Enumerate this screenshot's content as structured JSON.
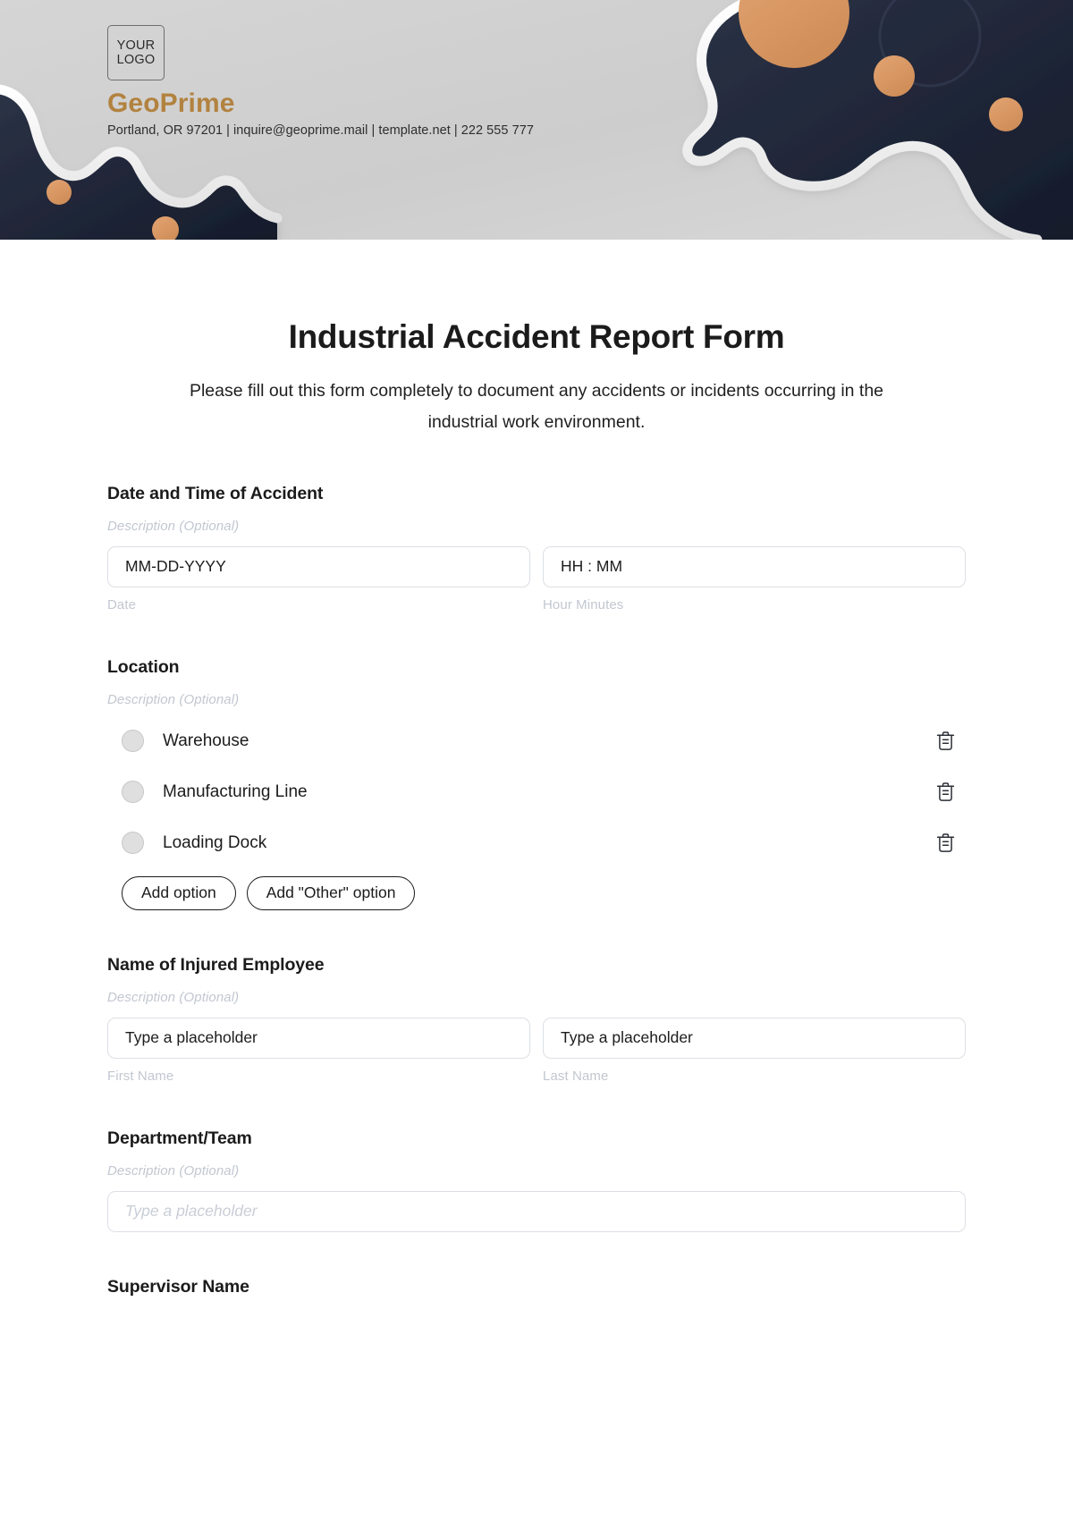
{
  "brand": {
    "logo_line1": "YOUR",
    "logo_line2": "LOGO",
    "name": "GeoPrime",
    "contact": "Portland, OR 97201 | inquire@geoprime.mail | template.net | 222 555 777",
    "accent_color": "#b2823f",
    "banner_dark": "#232b3b",
    "banner_bg": "#d2d2d2"
  },
  "form": {
    "title": "Industrial Accident Report Form",
    "subtitle": "Please fill out this form completely to document any accidents or incidents occurring in the industrial work environment."
  },
  "sections": {
    "datetime": {
      "label": "Date and Time of Accident",
      "description": "Description (Optional)",
      "date_value": "MM-DD-YYYY",
      "date_sublabel": "Date",
      "time_value": "HH : MM",
      "time_sublabel": "Hour Minutes"
    },
    "location": {
      "label": "Location",
      "description": "Description (Optional)",
      "options": [
        {
          "text": "Warehouse",
          "delete_icon": "trash-icon"
        },
        {
          "text": "Manufacturing Line",
          "delete_icon": "trash-icon"
        },
        {
          "text": "Loading Dock",
          "delete_icon": "trash-icon"
        }
      ],
      "add_option_label": "Add option",
      "add_other_label": "Add \"Other\" option"
    },
    "employee_name": {
      "label": "Name of Injured Employee",
      "description": "Description (Optional)",
      "first_value": "Type a placeholder",
      "first_sublabel": "First Name",
      "last_value": "Type a placeholder",
      "last_sublabel": "Last Name"
    },
    "department": {
      "label": "Department/Team",
      "description": "Description (Optional)",
      "placeholder": "Type a placeholder"
    },
    "supervisor": {
      "label": "Supervisor Name"
    }
  }
}
